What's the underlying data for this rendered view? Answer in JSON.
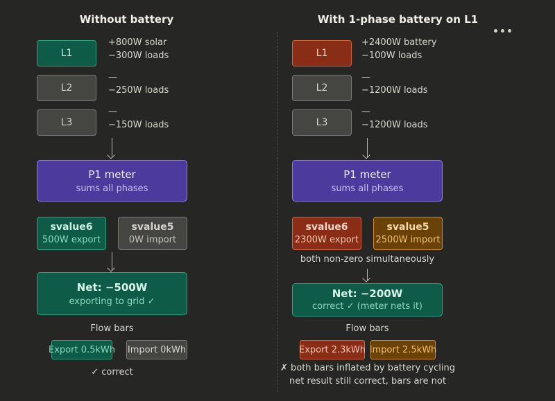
{
  "left": {
    "title": "Without battery",
    "phases": [
      {
        "label": "L1",
        "note1": "+800W solar",
        "note2": "−300W loads"
      },
      {
        "label": "L2",
        "note1": "—",
        "note2": "−250W loads"
      },
      {
        "label": "L3",
        "note1": "—",
        "note2": "−150W loads"
      }
    ],
    "meter": {
      "title": "P1 meter",
      "subtitle": "sums all phases"
    },
    "svalue6": {
      "name": "svalue6",
      "value": "500W export"
    },
    "svalue5": {
      "name": "svalue5",
      "value": "0W import"
    },
    "net": {
      "title": "Net: −500W",
      "subtitle": "exporting to grid ✓"
    },
    "flow_label": "Flow bars",
    "export_bar": "Export 0.5kWh",
    "import_bar": "Import 0kWh",
    "verdict": "✓ correct"
  },
  "right": {
    "title": "With 1-phase battery on L1",
    "phases": [
      {
        "label": "L1",
        "note1": "+2400W battery",
        "note2": "−100W loads"
      },
      {
        "label": "L2",
        "note1": "—",
        "note2": "−1200W loads"
      },
      {
        "label": "L3",
        "note1": "—",
        "note2": "−1200W loads"
      }
    ],
    "meter": {
      "title": "P1 meter",
      "subtitle": "sums all phases"
    },
    "svalue6": {
      "name": "svalue6",
      "value": "2300W export"
    },
    "svalue5": {
      "name": "svalue5",
      "value": "2500W import"
    },
    "simultaneous_note": "both non-zero simultaneously",
    "net": {
      "title": "Net: −200W",
      "subtitle": "correct ✓ (meter nets it)"
    },
    "flow_label": "Flow bars",
    "export_bar": "Export 2.3kWh",
    "import_bar": "Import 2.5kWh",
    "verdict_line1": "✗ both bars inflated by battery cycling",
    "verdict_line2": "net result still correct, bars are not"
  },
  "colors": {
    "background": "#262624",
    "green": "#0e5b48",
    "gray": "#454541",
    "red": "#8a2d16",
    "orange": "#6a4208",
    "purple": "#4c3a9c"
  },
  "icons": {
    "menu": "more-horizontal-icon"
  }
}
